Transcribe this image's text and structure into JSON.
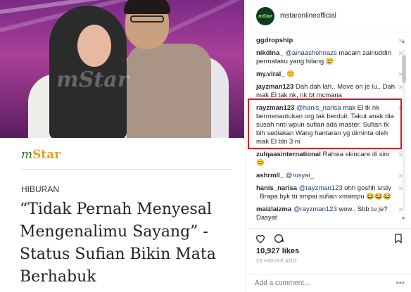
{
  "post": {
    "logo_prefix": "m",
    "logo_suffix": "Star",
    "watermark": "mStar",
    "category": "HIBURAN",
    "headline": "“Tidak Pernah Menyesal Mengenalimu Sayang” - Status Sufian Bikin Mata Berhabuk"
  },
  "panel": {
    "avatar_text": "mStar",
    "account": "mstaronlineofficial",
    "comments": [
      {
        "user": "ggdropship",
        "mention": "",
        "text": ""
      },
      {
        "user": "nikdina_",
        "mention": "@ainaashehnazs",
        "text": "macam zainuddin permataku yang hilang 😢"
      },
      {
        "user": "my.viral_",
        "mention": "",
        "text": "😊"
      },
      {
        "user": "jayzman123",
        "mention": "",
        "text": "Dah dah lah.. Move on je lu.. Dah mak El tak nk, nk bt mcmana"
      },
      {
        "user": "rayzman123",
        "mention": "@hanis_narisa",
        "text": "mak El tk nk bermenantukan org tak berduit. Takut anak dia susah nnti wpun sufian ada master. Sufian tk blh sediakan Wang hantaran yg diminta oleh mak El bln 3 ni"
      },
      {
        "user": "zulqaasinternational",
        "mention": "",
        "text": "Rahsia skincare di sini 😊"
      },
      {
        "user": "ashrmll_",
        "mention": "@rusyai_",
        "text": ""
      },
      {
        "user": "hanis_narisa",
        "mention": "@rayzman123",
        "text": "ohh goshh srsly . Brapa byk tu smpai sufian xmampu 😂😂😂"
      },
      {
        "user": "maizlaizma",
        "mention": "@rayzman123",
        "text": "wow.. Sbb tu je? Dasyat"
      }
    ],
    "likes": "10,927 likes",
    "time": "20 HOURS AGO",
    "add_comment_placeholder": "Add a comment...",
    "more_label": "•••"
  }
}
